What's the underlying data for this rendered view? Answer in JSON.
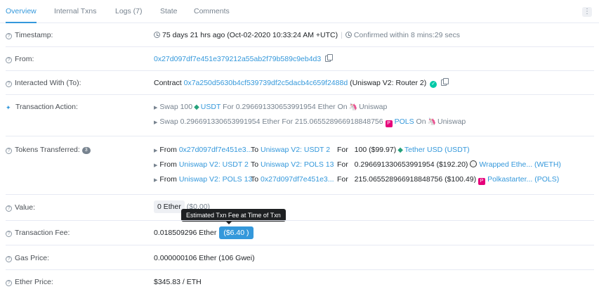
{
  "tabs": [
    {
      "label": "Overview",
      "active": true
    },
    {
      "label": "Internal Txns",
      "active": false
    },
    {
      "label": "Logs (7)",
      "active": false
    },
    {
      "label": "State",
      "active": false
    },
    {
      "label": "Comments",
      "active": false
    }
  ],
  "menu_icon": "kebab-menu-icon",
  "timestamp": {
    "label": "Timestamp:",
    "age": "75 days 21 hrs ago (Oct-02-2020 10:33:24 AM +UTC)",
    "confirm": "Confirmed within 8 mins:29 secs"
  },
  "from": {
    "label": "From:",
    "address": "0x27d097df7e451e379212a55ab2f79b589c9eb4d3"
  },
  "interacted": {
    "label": "Interacted With (To):",
    "prefix": "Contract",
    "address": "0x7a250d5630b4cf539739df2c5dacb4c659f2488d",
    "name": "(Uniswap V2: Router 2)"
  },
  "action": {
    "label": "Transaction Action:",
    "line1": {
      "swap": "Swap 100",
      "token": "USDT",
      "for": "For 0.296691330653991954 Ether On",
      "dex": "Uniswap"
    },
    "line2": {
      "swap": "Swap 0.296691330653991954 Ether For 215.065528966918848756",
      "token": "POLS",
      "on": "On",
      "dex": "Uniswap"
    }
  },
  "tokens": {
    "label": "Tokens Transferred:",
    "count": "3",
    "rows": [
      {
        "from_label": "From",
        "from": "0x27d097df7e451e3...",
        "to_label": "To",
        "to": "Uniswap V2: USDT 2",
        "for_label": "For",
        "amount": "100 ($99.97)",
        "token": "Tether USD (USDT)"
      },
      {
        "from_label": "From",
        "from": "Uniswap V2: USDT 2",
        "to_label": "To",
        "to": "Uniswap V2: POLS 13",
        "for_label": "For",
        "amount": "0.296691330653991954 ($192.20)",
        "token": "Wrapped Ethe... (WETH)"
      },
      {
        "from_label": "From",
        "from": "Uniswap V2: POLS 13",
        "to_label": "To",
        "to": "0x27d097df7e451e3...",
        "for_label": "For",
        "amount": "215.065528966918848756 ($100.49)",
        "token": "Polkastarter... (POLS)"
      }
    ]
  },
  "value": {
    "label": "Value:",
    "amount": "0 Ether",
    "usd": "($0.00)"
  },
  "fee": {
    "label": "Transaction Fee:",
    "amount": "0.018509296 Ether",
    "usd": "($6.40 )",
    "tooltip": "Estimated Txn Fee at Time of Txn"
  },
  "gas": {
    "label": "Gas Price:",
    "amount": "0.000000106 Ether (106 Gwei)"
  },
  "ether_price": {
    "label": "Ether Price:",
    "amount": "$345.83 / ETH"
  },
  "colors": {
    "accent": "#3498db",
    "success": "#00c9a7",
    "muted": "#77838f"
  }
}
